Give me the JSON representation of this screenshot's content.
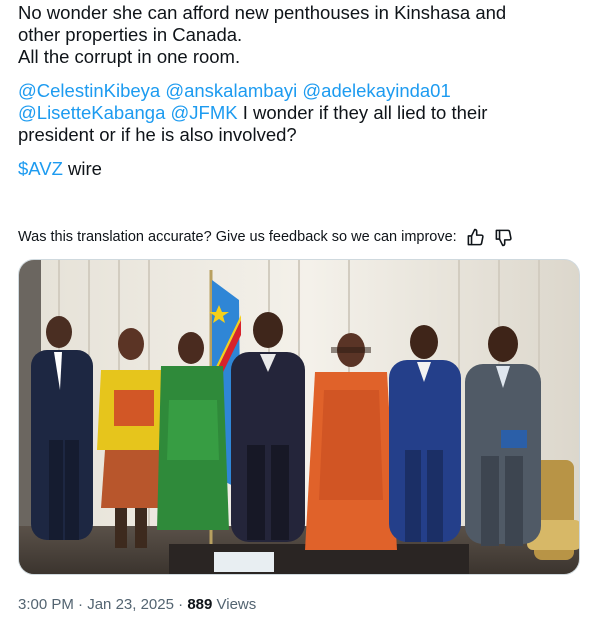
{
  "post": {
    "line1": "No wonder she can afford new penthouses in Kinshasa and",
    "line2": "other properties in Canada.",
    "line3": "All the corrupt in one room.",
    "mentions": [
      "@CelestinKibeya",
      "@anskalambayi",
      "@adelekayinda01",
      "@LisetteKabanga",
      "@JFMK"
    ],
    "mention_text_a": " I wonder if they all lied to their",
    "mention_text_b": "president or if he is also involved?",
    "cashtag": "$AVZ",
    "cashtag_suffix": " wire"
  },
  "feedback": {
    "prompt": "Was this translation accurate? Give us feedback so we can improve:",
    "thumbs_up_icon": "thumbs-up-icon",
    "thumbs_down_icon": "thumbs-down-icon"
  },
  "photo": {
    "subject": "photo-of-group"
  },
  "meta": {
    "time": "3:00 PM",
    "separator": " · ",
    "date": "Jan 23, 2025",
    "views_count": "889",
    "views_label": " Views"
  },
  "colors": {
    "link": "#1d9bf0",
    "text": "#0f1419",
    "secondary": "#536471"
  }
}
